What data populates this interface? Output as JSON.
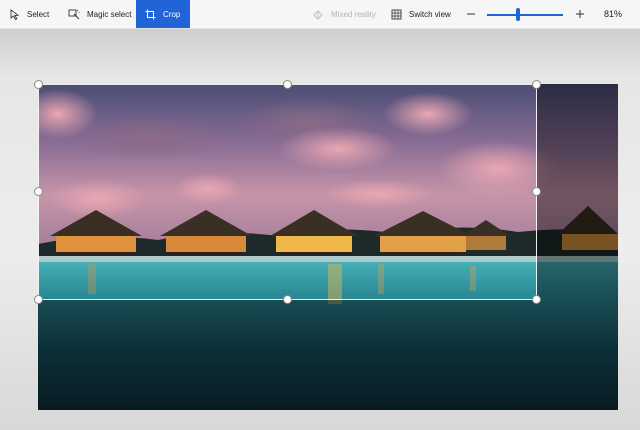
{
  "toolbar": {
    "select_label": "Select",
    "magic_select_label": "Magic select",
    "crop_label": "Crop",
    "mixed_reality_label": "Mixed reality",
    "switch_view_label": "Switch view",
    "zoom_percent": "81%",
    "zoom_level": 0.81,
    "accent_color": "#2064d8"
  },
  "icons": {
    "select": "cursor-arrow-icon",
    "magic_select": "magic-select-icon",
    "crop": "crop-icon",
    "mixed_reality": "mixed-reality-icon",
    "switch_view": "switch-view-icon",
    "zoom_out": "minus-icon",
    "zoom_in": "plus-icon"
  },
  "canvas": {
    "image_subject": "overwater bungalows at sunset"
  }
}
